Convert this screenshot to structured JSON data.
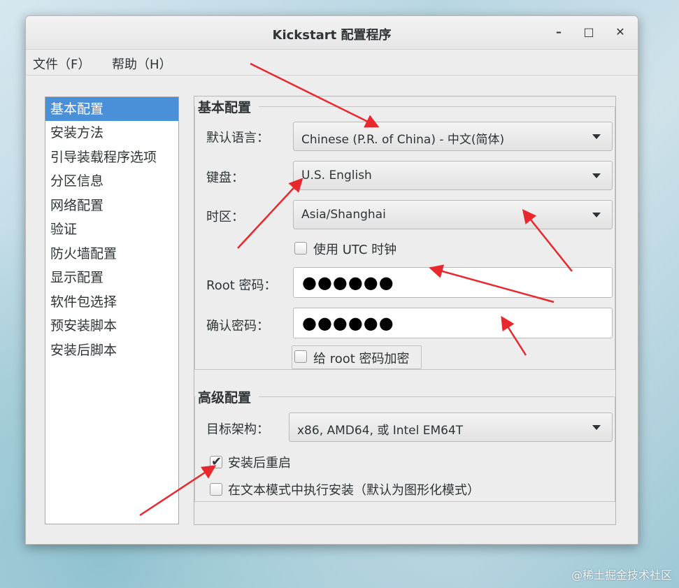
{
  "window": {
    "title": "Kickstart 配置程序",
    "minimize_glyph": "–",
    "maximize_glyph": "□",
    "close_glyph": "✕"
  },
  "menubar": [
    {
      "label": "文件（F）"
    },
    {
      "label": "帮助（H）"
    }
  ],
  "sidebar": {
    "selected_index": 0,
    "items": [
      {
        "label": "基本配置"
      },
      {
        "label": "安装方法"
      },
      {
        "label": "引导装载程序选项"
      },
      {
        "label": "分区信息"
      },
      {
        "label": "网络配置"
      },
      {
        "label": "验证"
      },
      {
        "label": "防火墙配置"
      },
      {
        "label": "显示配置"
      },
      {
        "label": "软件包选择"
      },
      {
        "label": "预安装脚本"
      },
      {
        "label": "安装后脚本"
      }
    ]
  },
  "basic": {
    "group_title": "基本配置",
    "language_label": "默认语言：",
    "language_value": "Chinese (P.R. of China) - 中文(简体)",
    "keyboard_label": "键盘：",
    "keyboard_value": "U.S. English",
    "timezone_label": "时区：",
    "timezone_value": "Asia/Shanghai",
    "utc_label": "使用  UTC 时钟",
    "utc_checked": false,
    "root_pw_label": "Root 密码：",
    "root_pw_value": "●●●●●●",
    "confirm_pw_label": "确认密码：",
    "confirm_pw_value": "●●●●●●",
    "encrypt_label": "给  root 密码加密",
    "encrypt_checked": false
  },
  "advanced": {
    "group_title": "高级配置",
    "arch_label": "目标架构：",
    "arch_value": "x86, AMD64, 或  Intel EM64T",
    "reboot_label": "安装后重启",
    "reboot_checked": true,
    "reboot_mark": "✔",
    "textmode_label": "在文本模式中执行安装（默认为图形化模式）",
    "textmode_checked": false
  },
  "annotation_color": "#e8282c",
  "watermark": "@稀土掘金技术社区"
}
